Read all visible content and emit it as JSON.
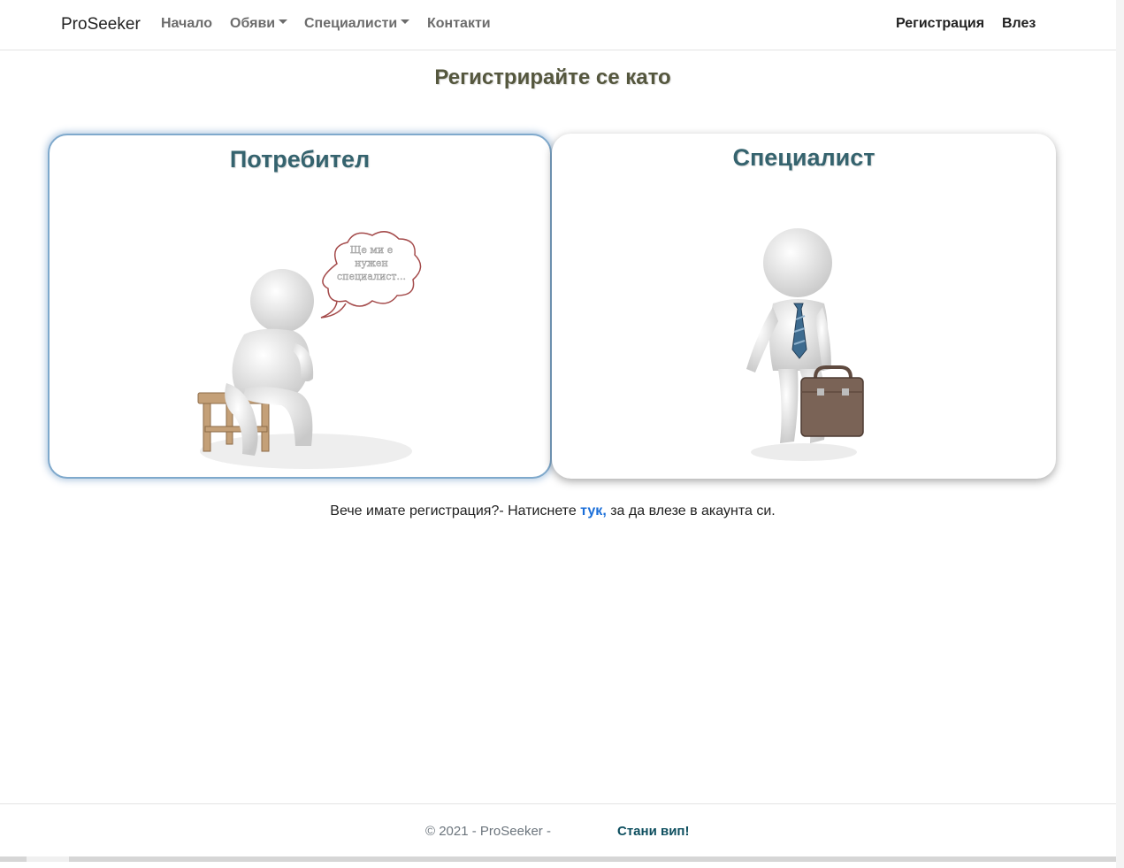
{
  "navbar": {
    "brand": "ProSeeker",
    "items": [
      {
        "label": "Начало",
        "dropdown": false
      },
      {
        "label": "Обяви",
        "dropdown": true
      },
      {
        "label": "Специалисти",
        "dropdown": true
      },
      {
        "label": "Контакти",
        "dropdown": false
      }
    ],
    "register": "Регистрация",
    "login": "Влез"
  },
  "main": {
    "heading": "Регистрирайте се като",
    "cards": [
      {
        "title": "Потребител",
        "bubble_text": [
          "Ще ми е",
          "нужен",
          "специалист..."
        ]
      },
      {
        "title": "Специалист"
      }
    ],
    "login_prefix": "Вече имате регистрация?- Натиснете ",
    "login_link": "тук,",
    "login_suffix": " за да влезе в акаунта си."
  },
  "footer": {
    "copyright": "© 2021 - ProSeeker -",
    "vip": "Стани вип!"
  },
  "colors": {
    "heading": "#55573e",
    "card_title": "#35636e",
    "link": "#1a6ed8",
    "vip": "#0e4f5f"
  }
}
